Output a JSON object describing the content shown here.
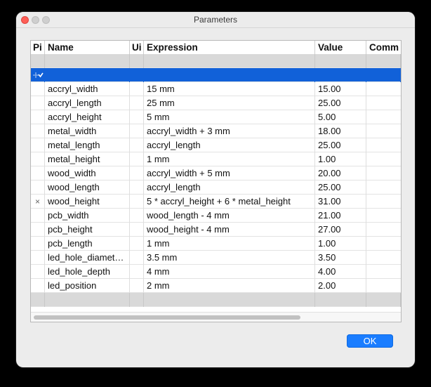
{
  "window": {
    "title": "Parameters"
  },
  "columns": [
    "Pi",
    "Name",
    "Ui",
    "Expression",
    "Value",
    "Comm"
  ],
  "rows": [
    {
      "name": "accryl_width",
      "expression": "15 mm",
      "value": "15.00"
    },
    {
      "name": "accryl_length",
      "expression": "25 mm",
      "value": "25.00"
    },
    {
      "name": "accryl_height",
      "expression": "5 mm",
      "value": "5.00"
    },
    {
      "name": "metal_width",
      "expression": "accryl_width + 3 mm",
      "value": "18.00"
    },
    {
      "name": "metal_length",
      "expression": "accryl_length",
      "value": "25.00"
    },
    {
      "name": "metal_height",
      "expression": "1 mm",
      "value": "1.00"
    },
    {
      "name": "wood_width",
      "expression": "accryl_width + 5 mm",
      "value": "20.00"
    },
    {
      "name": "wood_length",
      "expression": "accryl_length",
      "value": "25.00"
    },
    {
      "name": "wood_height",
      "expression": "5 * accryl_height + 6 * metal_height",
      "value": "31.00",
      "marker": "×"
    },
    {
      "name": "pcb_width",
      "expression": "wood_length - 4 mm",
      "value": "21.00"
    },
    {
      "name": "pcb_height",
      "expression": "wood_height - 4 mm",
      "value": "27.00"
    },
    {
      "name": "pcb_length",
      "expression": "1 mm",
      "value": "1.00"
    },
    {
      "name": "led_hole_diamet…",
      "expression": "3.5 mm",
      "value": "3.50"
    },
    {
      "name": "led_hole_depth",
      "expression": "4 mm",
      "value": "4.00"
    },
    {
      "name": "led_position",
      "expression": "2 mm",
      "value": "2.00"
    }
  ],
  "buttons": {
    "ok": "OK"
  },
  "colors": {
    "selection": "#1161d9",
    "ok_button": "#1a7dff",
    "group_row": "#d9d9d9"
  },
  "icons": {
    "pin_add": "pin-add-icon",
    "delete": "delete-x-icon"
  }
}
